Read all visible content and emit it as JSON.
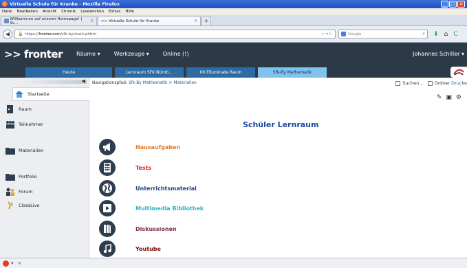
{
  "window": {
    "title": "Virtuelle Schule für Kranke - Mozilla Firefox",
    "min_glyph": "_",
    "max_glyph": "□",
    "close_glyph": "✕"
  },
  "menubar": [
    "Datei",
    "Bearbeiten",
    "Ansicht",
    "Chronik",
    "Lesezeichen",
    "Extras",
    "Hilfe"
  ],
  "tabs": [
    {
      "label": "Willkommen auf unserer Homepage! | Sc...",
      "close": "×"
    },
    {
      "label": ">> Virtuelle Schule für Kranke",
      "close": "×"
    }
  ],
  "new_tab_glyph": "+",
  "address": {
    "back_glyph": "◀",
    "lock_glyph": "🔒",
    "prefix": "https://",
    "host": "fronter.com",
    "path": "/sfk-by/main.phtml",
    "tools": "☆ ▾ C",
    "search_placeholder": "Google",
    "search_glyph": "⌕"
  },
  "nav_tools": {
    "download": "⬇",
    "home": "⌂",
    "reload": "C"
  },
  "fronter": {
    "logo": ">> fronter",
    "menu": [
      "Räume ▾",
      "Werkzeuge ▾",
      "Online (!)"
    ],
    "user": "Johannes Schiller ▾",
    "tabs": [
      "Heute",
      "Lernraum SFK Nürnb...",
      "00 Elluminate Raum",
      "Sfk-By Mathematik"
    ],
    "active_tab": 3
  },
  "sidebar": {
    "collapse_glyph": "◀",
    "items": [
      {
        "label": "Startseite",
        "icon": "home-icon"
      },
      {
        "label": "Raum",
        "icon": "door-icon"
      },
      {
        "label": "Teilnehmer",
        "icon": "people-icon"
      },
      {
        "label": "Materialien",
        "icon": "folder-icon"
      },
      {
        "label": "Portfolio",
        "icon": "portfolio-folder-icon"
      },
      {
        "label": "Forum",
        "icon": "forum-icon"
      },
      {
        "label": "ClassLive",
        "icon": "classlive-icon"
      }
    ]
  },
  "breadcrumb": {
    "prefix": "Navigationspfad:",
    "path": "Sfk-By Mathematik > Materialien"
  },
  "tools": {
    "suchen": "Suchen...",
    "ordner": "Ordner",
    "drucken": "Drucke"
  },
  "toolbar_glyphs": {
    "edit": "✎",
    "save": "▣",
    "settings": "⚙"
  },
  "main": {
    "title": "Schüler Lernraum",
    "links": [
      {
        "label": "Hausaufgaben",
        "color": "#e8761a",
        "icon": "megaphone-icon"
      },
      {
        "label": "Tests",
        "color": "#d9232a",
        "icon": "calculator-icon"
      },
      {
        "label": "Unterrichtsmaterial",
        "color": "#1f3f7a",
        "icon": "globe-icon"
      },
      {
        "label": "Multimedia Bibliothek",
        "color": "#2bb3c4",
        "icon": "media-icon"
      },
      {
        "label": "Diskussionen",
        "color": "#7b2a4e",
        "icon": "books-icon"
      },
      {
        "label": "Youtube",
        "color": "#7a1414",
        "icon": "music-icon"
      }
    ]
  },
  "status": {
    "close": "×"
  }
}
